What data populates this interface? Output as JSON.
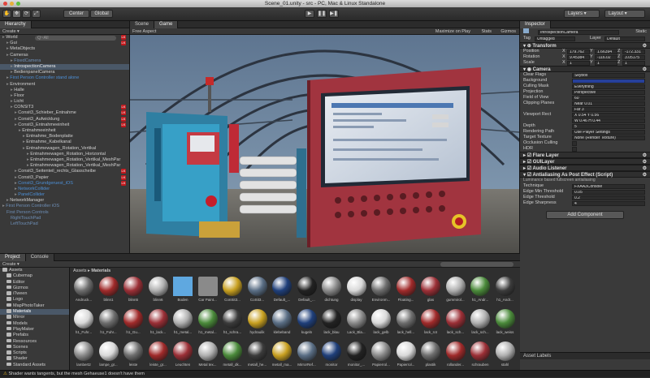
{
  "window": {
    "title": "Scene_01.unity - src - PC, Mac & Linux Standalone"
  },
  "toolbar": {
    "center": "Center",
    "global": "Global",
    "layers": "Layers",
    "layout": "Layout"
  },
  "hierarchy": {
    "tab": "Hierarchy",
    "create": "Create",
    "search": "Q~All",
    "items": [
      {
        "label": "World",
        "indent": 0,
        "style": "normal",
        "lock": true
      },
      {
        "label": "Gui",
        "indent": 1,
        "style": "normal",
        "lock": true
      },
      {
        "label": "MetaObjects",
        "indent": 1,
        "style": "normal",
        "lock": false
      },
      {
        "label": "Cameras",
        "indent": 1,
        "style": "normal",
        "lock": false
      },
      {
        "label": "FixedCamera",
        "indent": 2,
        "style": "dim",
        "lock": false
      },
      {
        "label": "IntrospectionCamera",
        "indent": 2,
        "style": "sel",
        "lock": false
      },
      {
        "label": "BedienpanelCamera",
        "indent": 2,
        "style": "normal",
        "lock": false
      },
      {
        "label": "First Person Controller stand alone",
        "indent": 1,
        "style": "blue",
        "lock": false
      },
      {
        "label": "Environment",
        "indent": 1,
        "style": "normal",
        "lock": false
      },
      {
        "label": "Halle",
        "indent": 2,
        "style": "normal",
        "lock": false
      },
      {
        "label": "Floor",
        "indent": 2,
        "style": "normal",
        "lock": false
      },
      {
        "label": "Licht",
        "indent": 2,
        "style": "normal",
        "lock": false
      },
      {
        "label": "CONSIT3",
        "indent": 2,
        "style": "normal",
        "lock": true
      },
      {
        "label": "Consit3_Schieber_Entnahme",
        "indent": 3,
        "style": "normal",
        "lock": true
      },
      {
        "label": "Consit3_Aufwicklung",
        "indent": 3,
        "style": "normal",
        "lock": true
      },
      {
        "label": "Consit3_Entnahmeeinheit",
        "indent": 3,
        "style": "normal",
        "lock": true
      },
      {
        "label": "Entnahmeeinheit",
        "indent": 4,
        "style": "normal",
        "lock": false
      },
      {
        "label": "Entnahme_Bodenplatte",
        "indent": 5,
        "style": "normal",
        "lock": false
      },
      {
        "label": "Entnahme_Kabelkanal",
        "indent": 5,
        "style": "normal",
        "lock": false
      },
      {
        "label": "Entnahmewagen_Rotation_Vertikal",
        "indent": 5,
        "style": "normal",
        "lock": false
      },
      {
        "label": "Entnahmewagen_Rotation_Horizontal",
        "indent": 6,
        "style": "normal",
        "lock": false
      },
      {
        "label": "Entnahmewagen_Rotation_Vertikal_MeshPar",
        "indent": 6,
        "style": "normal",
        "lock": false
      },
      {
        "label": "Entnahmewagen_Rotation_Vertikal_MeshPar",
        "indent": 6,
        "style": "normal",
        "lock": false
      },
      {
        "label": "Consit3_Seitenteil_rechts_Glasscheibe",
        "indent": 3,
        "style": "normal",
        "lock": true
      },
      {
        "label": "Consit3_Papier",
        "indent": 3,
        "style": "normal",
        "lock": true
      },
      {
        "label": "Consit3_Grundgeruest_iOS",
        "indent": 3,
        "style": "blue",
        "lock": true
      },
      {
        "label": "NetworkCollider",
        "indent": 3,
        "style": "blue",
        "lock": false
      },
      {
        "label": "PanelCollider",
        "indent": 3,
        "style": "blue",
        "lock": false
      },
      {
        "label": "NetworkManager",
        "indent": 1,
        "style": "normal",
        "lock": false
      },
      {
        "label": "First Person Controller iOS",
        "indent": 0,
        "style": "dim",
        "lock": false
      },
      {
        "label": "First Person Controls",
        "indent": 1,
        "style": "dim",
        "lock": false
      },
      {
        "label": "RightTouchPad",
        "indent": 2,
        "style": "dim",
        "lock": false
      },
      {
        "label": "LeftTouchPad",
        "indent": 2,
        "style": "dim",
        "lock": false
      }
    ]
  },
  "scene": {
    "tab_scene": "Scene",
    "tab_game": "Game",
    "aspect": "Free Aspect",
    "maximize": "Maximize on Play",
    "stats": "Stats",
    "gizmos": "Gizmos"
  },
  "inspector": {
    "tab": "Inspector",
    "object_name": "IntrospectionCamera",
    "static": "Static",
    "tag_label": "Tag",
    "tag": "Untagged",
    "layer_label": "Layer",
    "layer": "Default",
    "transform": {
      "title": "Transform",
      "rows": [
        {
          "label": "Position",
          "x": "179.762",
          "y": "1.66394",
          "z": "-172.331"
        },
        {
          "label": "Rotation",
          "x": "9.45384",
          "y": "-116.02",
          "z": "3.05175"
        },
        {
          "label": "Scale",
          "x": "1",
          "y": "1",
          "z": "1"
        }
      ]
    },
    "camera": {
      "title": "Camera",
      "rows": [
        {
          "label": "Clear Flags",
          "value": "Skybox"
        },
        {
          "label": "Background",
          "value": ""
        },
        {
          "label": "Culling Mask",
          "value": "Everything"
        },
        {
          "label": "Projection",
          "value": "Perspective"
        },
        {
          "label": "Field of View",
          "value": "60"
        },
        {
          "label": "Clipping Planes",
          "value": "Near 0.01"
        },
        {
          "label": "",
          "value": "Far 3"
        },
        {
          "label": "Viewport Rect",
          "value": "X 0.54   Y 0.56"
        },
        {
          "label": "",
          "value": "W 0.46   H 0.44"
        },
        {
          "label": "Depth",
          "value": "5"
        },
        {
          "label": "Rendering Path",
          "value": "Use Player Settings"
        },
        {
          "label": "Target Texture",
          "value": "None (Render Texture)"
        },
        {
          "label": "Occlusion Culling",
          "value": ""
        },
        {
          "label": "HDR",
          "value": ""
        }
      ]
    },
    "components": [
      "Flare Layer",
      "GUILayer",
      "Audio Listener",
      "Antialiasing As Post Effect (Script)"
    ],
    "aa_desc": "Luminance based fullscreen antialiasing",
    "aa_rows": [
      {
        "label": "Technique",
        "value": "FXAA3Console"
      },
      {
        "label": "Edge Min Threshold",
        "value": "0.05"
      },
      {
        "label": "Edge Threshold",
        "value": "0.2"
      },
      {
        "label": "Edge Sharpness",
        "value": "4"
      }
    ],
    "add_component": "Add Component",
    "asset_labels": "Asset Labels"
  },
  "project": {
    "tab_project": "Project",
    "tab_console": "Console",
    "create": "Create",
    "breadcrumb_root": "Assets",
    "breadcrumb_current": "Materials",
    "tree": [
      "Assets",
      "Cubemap",
      "Editor",
      "Gizmos",
      "iTween",
      "Logo",
      "MapPhotoTaker",
      "Materials",
      "Mirror",
      "Models",
      "PlayMaker",
      "Prefabs",
      "Ressources",
      "Scenes",
      "Scripts",
      "Shader",
      "Standard Assets"
    ],
    "materials": [
      [
        "Andruck...",
        "blinn1",
        "blinn5",
        "blinn6",
        "Boden",
        "Car Paint...",
        "ConSit3...",
        "CoSit3...",
        "Default_...",
        "Default_...",
        "dichtung",
        "display",
        "Environm...",
        "Floating...",
        "glas",
        "gummirol...",
        "h1_Andr...",
        "h1_Andr..."
      ],
      [
        "h1_Fuhr...",
        "h1_Fuhr...",
        "h1_Gu...",
        "h1_lack...",
        "h1_metal...",
        "h1_metal...",
        "h1_schra...",
        "hydraulik",
        "klebeband",
        "kugeln",
        "lack_blau",
        "Lack_Bla...",
        "lack_gelb",
        "lack_hell...",
        "lack_rot",
        "lack_sch...",
        "lack_sch...",
        "lack_weiss"
      ],
      [
        "lambert2",
        "lampe_gr...",
        "leiste",
        "leiste_gr...",
        "Leuchten",
        "Metal tex...",
        "metall_dk...",
        "metall_he...",
        "metall_ma...",
        "MirrorRef...",
        "monitor",
        "monitor_...",
        "Papierrol...",
        "Papierrol...",
        "plastik",
        "rollander...",
        "schrauben",
        "stahl"
      ]
    ]
  },
  "status": {
    "message": "Shader wants tangents, but the mesh Gehaeuse1 doesn't have them"
  }
}
